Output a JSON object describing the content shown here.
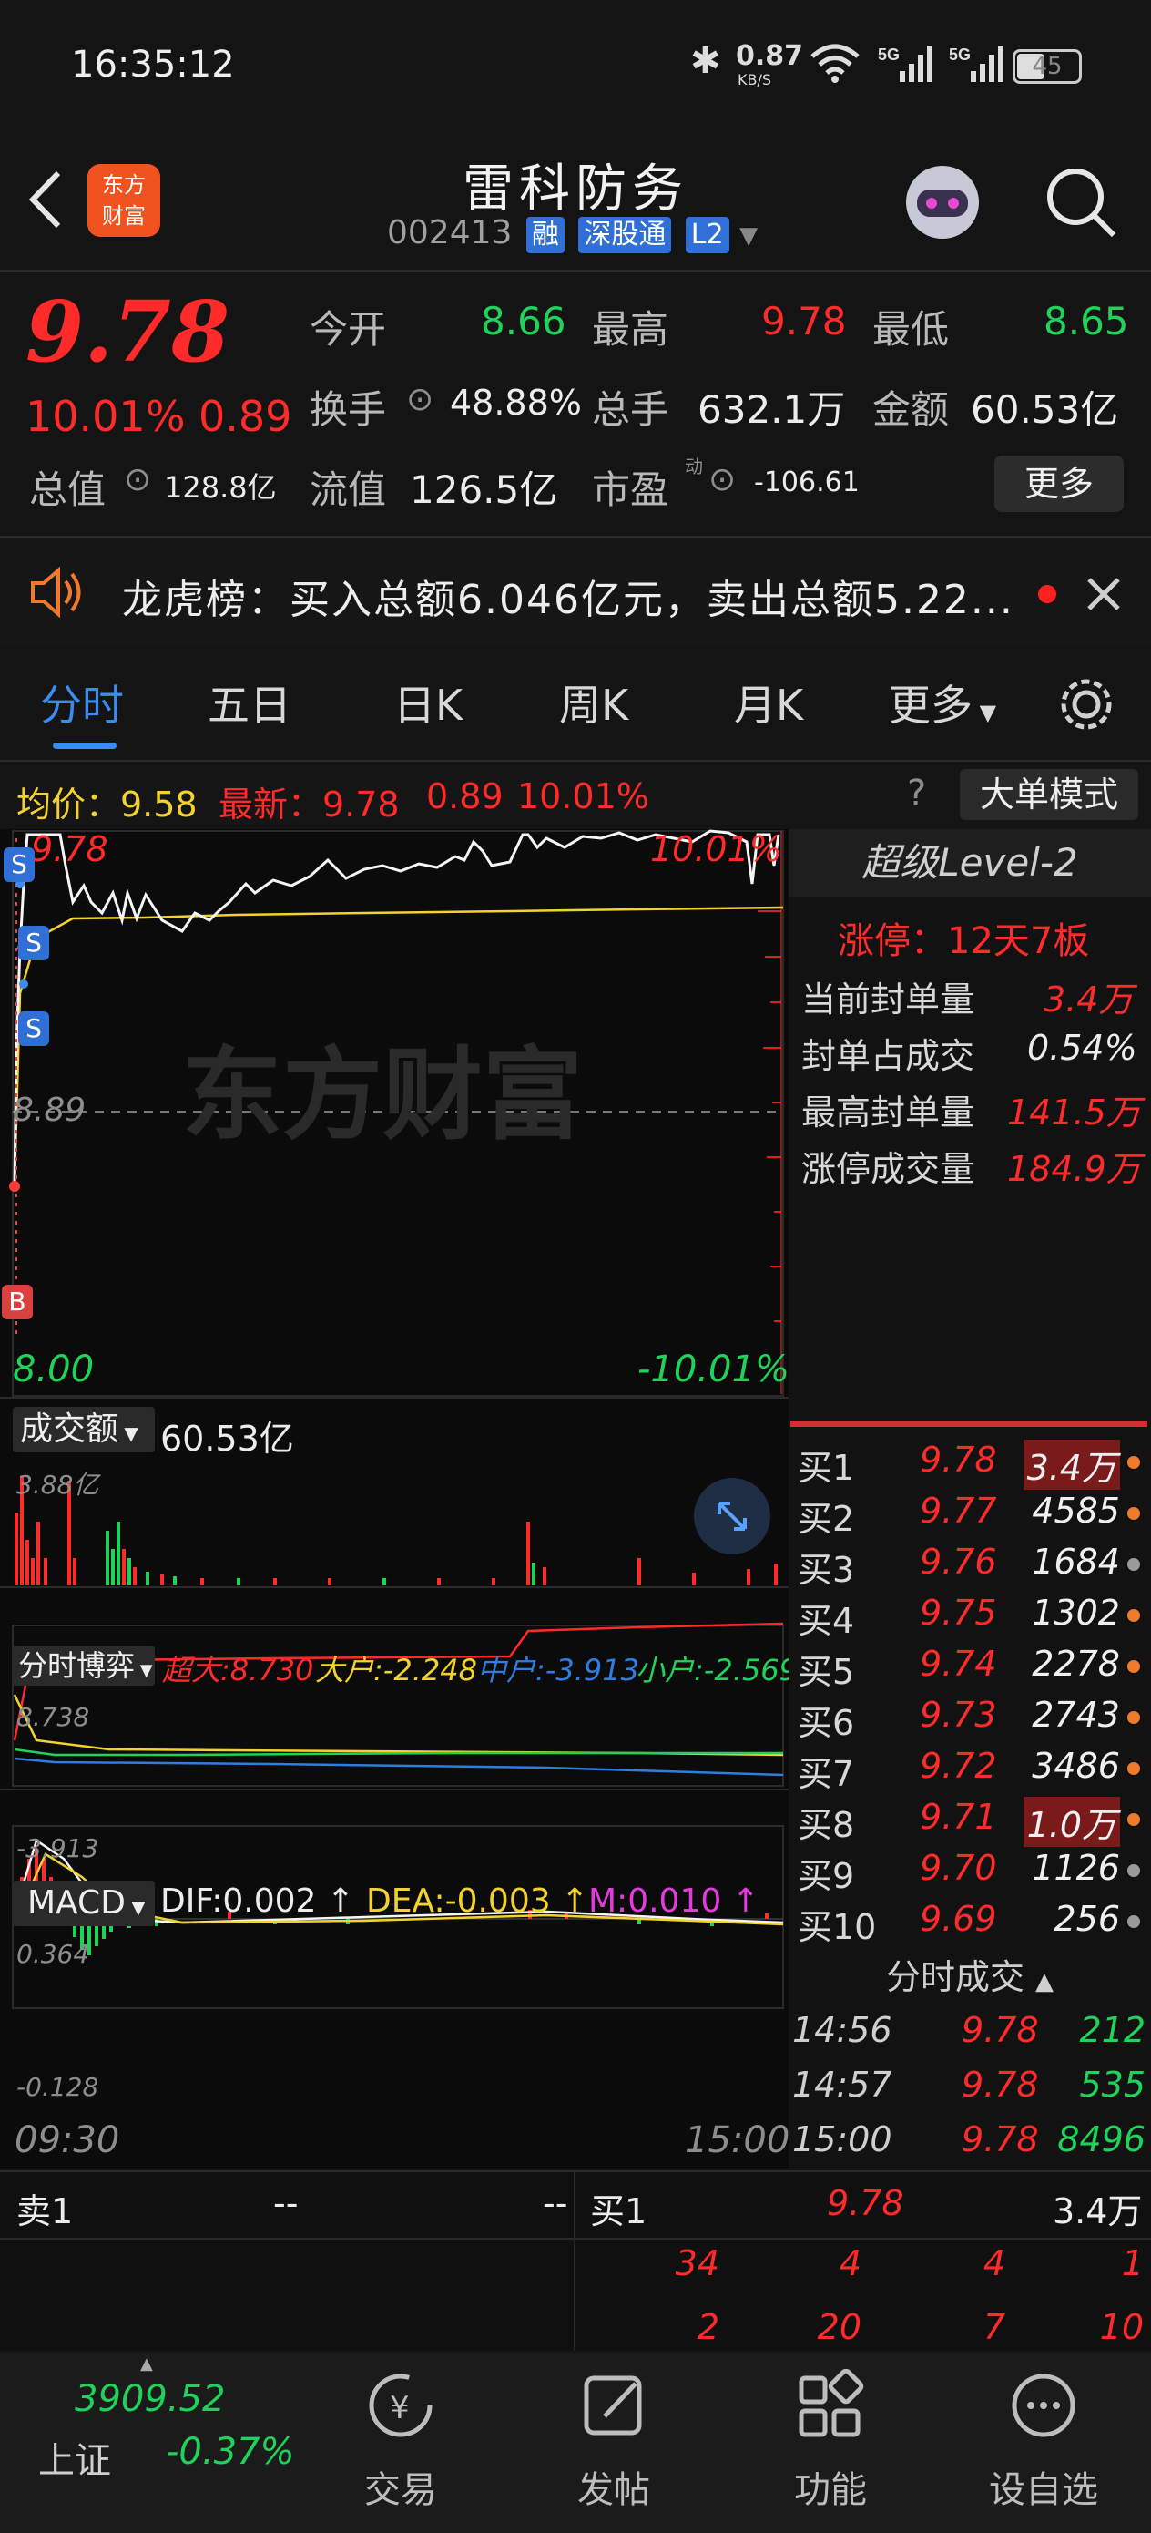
{
  "status_bar": {
    "time": "16:35:12",
    "net_speed": "0.87",
    "net_unit": "KB/S",
    "battery": "45"
  },
  "header": {
    "title": "雷科防务",
    "code": "002413",
    "tags": [
      "融",
      "深股通",
      "L2"
    ],
    "logo_text": "东方财富"
  },
  "quote": {
    "price": "9.78",
    "pct": "10.01%",
    "change": "0.89",
    "fields": [
      {
        "label": "今开",
        "value": "8.66",
        "color": "green"
      },
      {
        "label": "最高",
        "value": "9.78",
        "color": "red"
      },
      {
        "label": "最低",
        "value": "8.65",
        "color": "green"
      },
      {
        "label": "换手",
        "value": "48.88%",
        "color": "white"
      },
      {
        "label": "总手",
        "value": "632.1万",
        "color": "white"
      },
      {
        "label": "金额",
        "value": "60.53亿",
        "color": "white"
      },
      {
        "label": "总值",
        "value": "128.8亿",
        "color": "white"
      },
      {
        "label": "流值",
        "value": "126.5亿",
        "color": "white"
      },
      {
        "label": "市盈",
        "value": "-106.61",
        "color": "white",
        "sup": "动"
      }
    ],
    "more_label": "更多"
  },
  "notice": {
    "text": "龙虎榜：买入总额6.046亿元，卖出总额5.22..."
  },
  "tabs": [
    "分时",
    "五日",
    "日K",
    "周K",
    "月K",
    "更多"
  ],
  "chart_header": {
    "avg_label": "均价：9.58",
    "latest_label": "最新：9.78",
    "chg": "0.89",
    "pct": "10.01%",
    "mode_button": "大单模式"
  },
  "intraday": {
    "price_max": "9.78",
    "price_mid": "8.89",
    "price_min": "8.00",
    "pct_max": "10.01%",
    "pct_min": "-10.01%",
    "markers": [
      "S",
      "S",
      "S",
      "B"
    ],
    "watermark": "东方财富",
    "start_time": "09:30",
    "end_time": "15:00"
  },
  "volume_panel": {
    "selector": "成交额",
    "value": "60.53亿",
    "max_label": "3.88亿"
  },
  "game_panel": {
    "selector": "分时博弈",
    "super": "超大:8.730",
    "big": "大户:-2.248",
    "mid": "中户:-3.913",
    "small": "小户:-2.569",
    "max_label": "8.738",
    "min_label": "-3.913"
  },
  "macd_panel": {
    "selector": "MACD",
    "dif": "DIF:0.002",
    "dea": "DEA:-0.003",
    "m": "M:0.010",
    "max_label": "0.364",
    "min_label": "-0.128"
  },
  "level2": {
    "title": "超级Level-2",
    "limit_up": "涨停：12天7板",
    "rows": [
      {
        "label": "当前封单量",
        "value": "3.4万"
      },
      {
        "label": "封单占成交",
        "value": "0.54%"
      },
      {
        "label": "最高封单量",
        "value": "141.5万"
      },
      {
        "label": "涨停成交量",
        "value": "184.9万"
      }
    ]
  },
  "order_book": [
    {
      "label": "买1",
      "price": "9.78",
      "vol": "3.4万"
    },
    {
      "label": "买2",
      "price": "9.77",
      "vol": "4585"
    },
    {
      "label": "买3",
      "price": "9.76",
      "vol": "1684"
    },
    {
      "label": "买4",
      "price": "9.75",
      "vol": "1302"
    },
    {
      "label": "买5",
      "price": "9.74",
      "vol": "2278"
    },
    {
      "label": "买6",
      "price": "9.73",
      "vol": "2743"
    },
    {
      "label": "买7",
      "price": "9.72",
      "vol": "3486"
    },
    {
      "label": "买8",
      "price": "9.71",
      "vol": "1.0万"
    },
    {
      "label": "买9",
      "price": "9.70",
      "vol": "1126"
    },
    {
      "label": "买10",
      "price": "9.69",
      "vol": "256"
    }
  ],
  "ticks_title": "分时成交",
  "ticks": [
    {
      "time": "14:56",
      "price": "9.78",
      "vol": "212"
    },
    {
      "time": "14:57",
      "price": "9.78",
      "vol": "535"
    },
    {
      "time": "15:00",
      "price": "9.78",
      "vol": "8496"
    }
  ],
  "level2_queue": {
    "sell_label": "卖1",
    "sell_price": "--",
    "sell_vol": "--",
    "buy_label": "买1",
    "buy_price": "9.78",
    "buy_vol": "3.4万",
    "queue_row1": [
      "34",
      "4",
      "4",
      "1"
    ],
    "queue_row2": [
      "2",
      "20",
      "7",
      "10"
    ]
  },
  "bottom_nav": {
    "index_value": "3909.52",
    "index_name": "上证",
    "index_pct": "-0.37%",
    "items": [
      "交易",
      "发帖",
      "功能",
      "设自选"
    ]
  },
  "colors": {
    "up": "#ff2b2b",
    "down": "#1fd35a",
    "accent": "#3b8bf0",
    "avg": "#f3d22e"
  }
}
